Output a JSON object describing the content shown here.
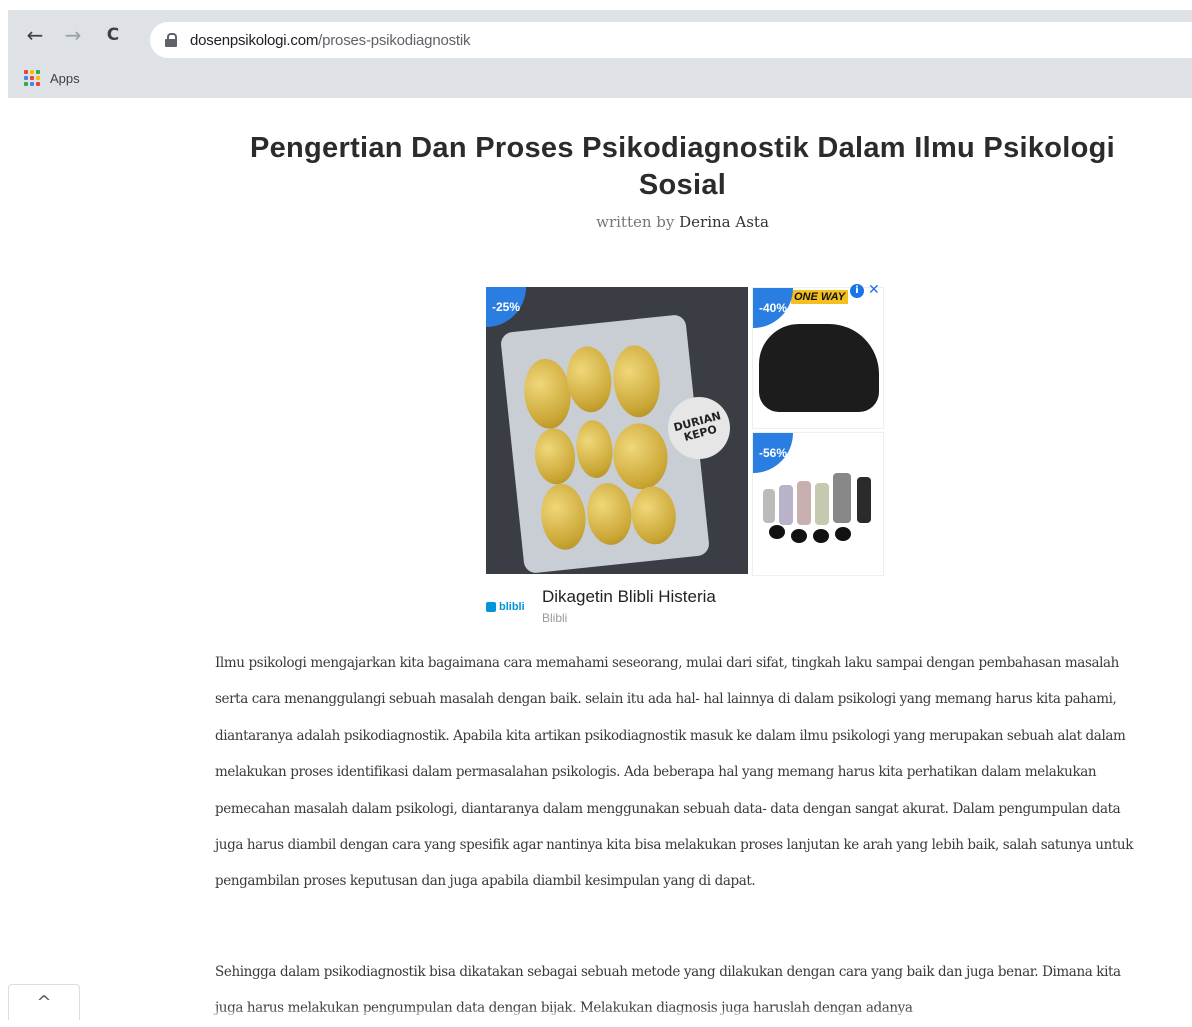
{
  "browser": {
    "back_icon": "←",
    "forward_icon": "→",
    "reload_icon": "C",
    "url_domain": "dosenpsikologi.com",
    "url_path": "/proses-psikodiagnostik",
    "bookmarks": [
      {
        "label": "Apps"
      }
    ]
  },
  "article": {
    "title": "Pengertian Dan Proses Psikodiagnostik Dalam Ilmu Psikologi Sosial",
    "byline_prefix": "written by",
    "author": "Derina Asta",
    "paragraphs": [
      "Ilmu psikologi mengajarkan kita bagaimana cara memahami seseorang, mulai dari sifat, tingkah laku sampai dengan pembahasan masalah serta cara menanggulangi sebuah masalah dengan baik. selain itu ada hal- hal lainnya di dalam psikologi yang memang harus kita pahami, diantaranya adalah psikodiagnostik. Apabila kita artikan psikodiagnostik masuk ke dalam ilmu psikologi yang merupakan sebuah alat dalam melakukan proses identifikasi dalam permasalahan psikologis. Ada beberapa hal yang memang harus kita perhatikan dalam melakukan pemecahan masalah dalam psikologi, diantaranya dalam menggunakan sebuah data- data dengan sangat akurat. Dalam pengumpulan data juga harus diambil dengan cara yang spesifik agar nantinya kita bisa melakukan proses lanjutan ke arah yang lebih baik, salah satunya untuk pengambilan proses keputusan dan juga apabila diambil kesimpulan yang di dapat.",
      "Sehingga dalam psikodiagnostik bisa dikatakan sebagai sebuah metode yang dilakukan dengan cara yang baik dan juga benar. Dimana kita juga harus melakukan pengumpulan data dengan bijak. Melakukan diagnosis juga haruslah dengan adanya"
    ]
  },
  "ad": {
    "badges": [
      "-25%",
      "-40%",
      "-56%"
    ],
    "sticker_text": "DURIAN KEPO",
    "brand_text": "ONE WAY",
    "info_icon": "i",
    "close_icon": "✕",
    "logo_text": "blibli",
    "title": "Dikagetin Blibli Histeria",
    "advertiser": "Blibli"
  },
  "scroll_top_icon": "^",
  "colors": {
    "link_blue": "#2a7de1",
    "chrome_bg": "#dee1e6"
  }
}
